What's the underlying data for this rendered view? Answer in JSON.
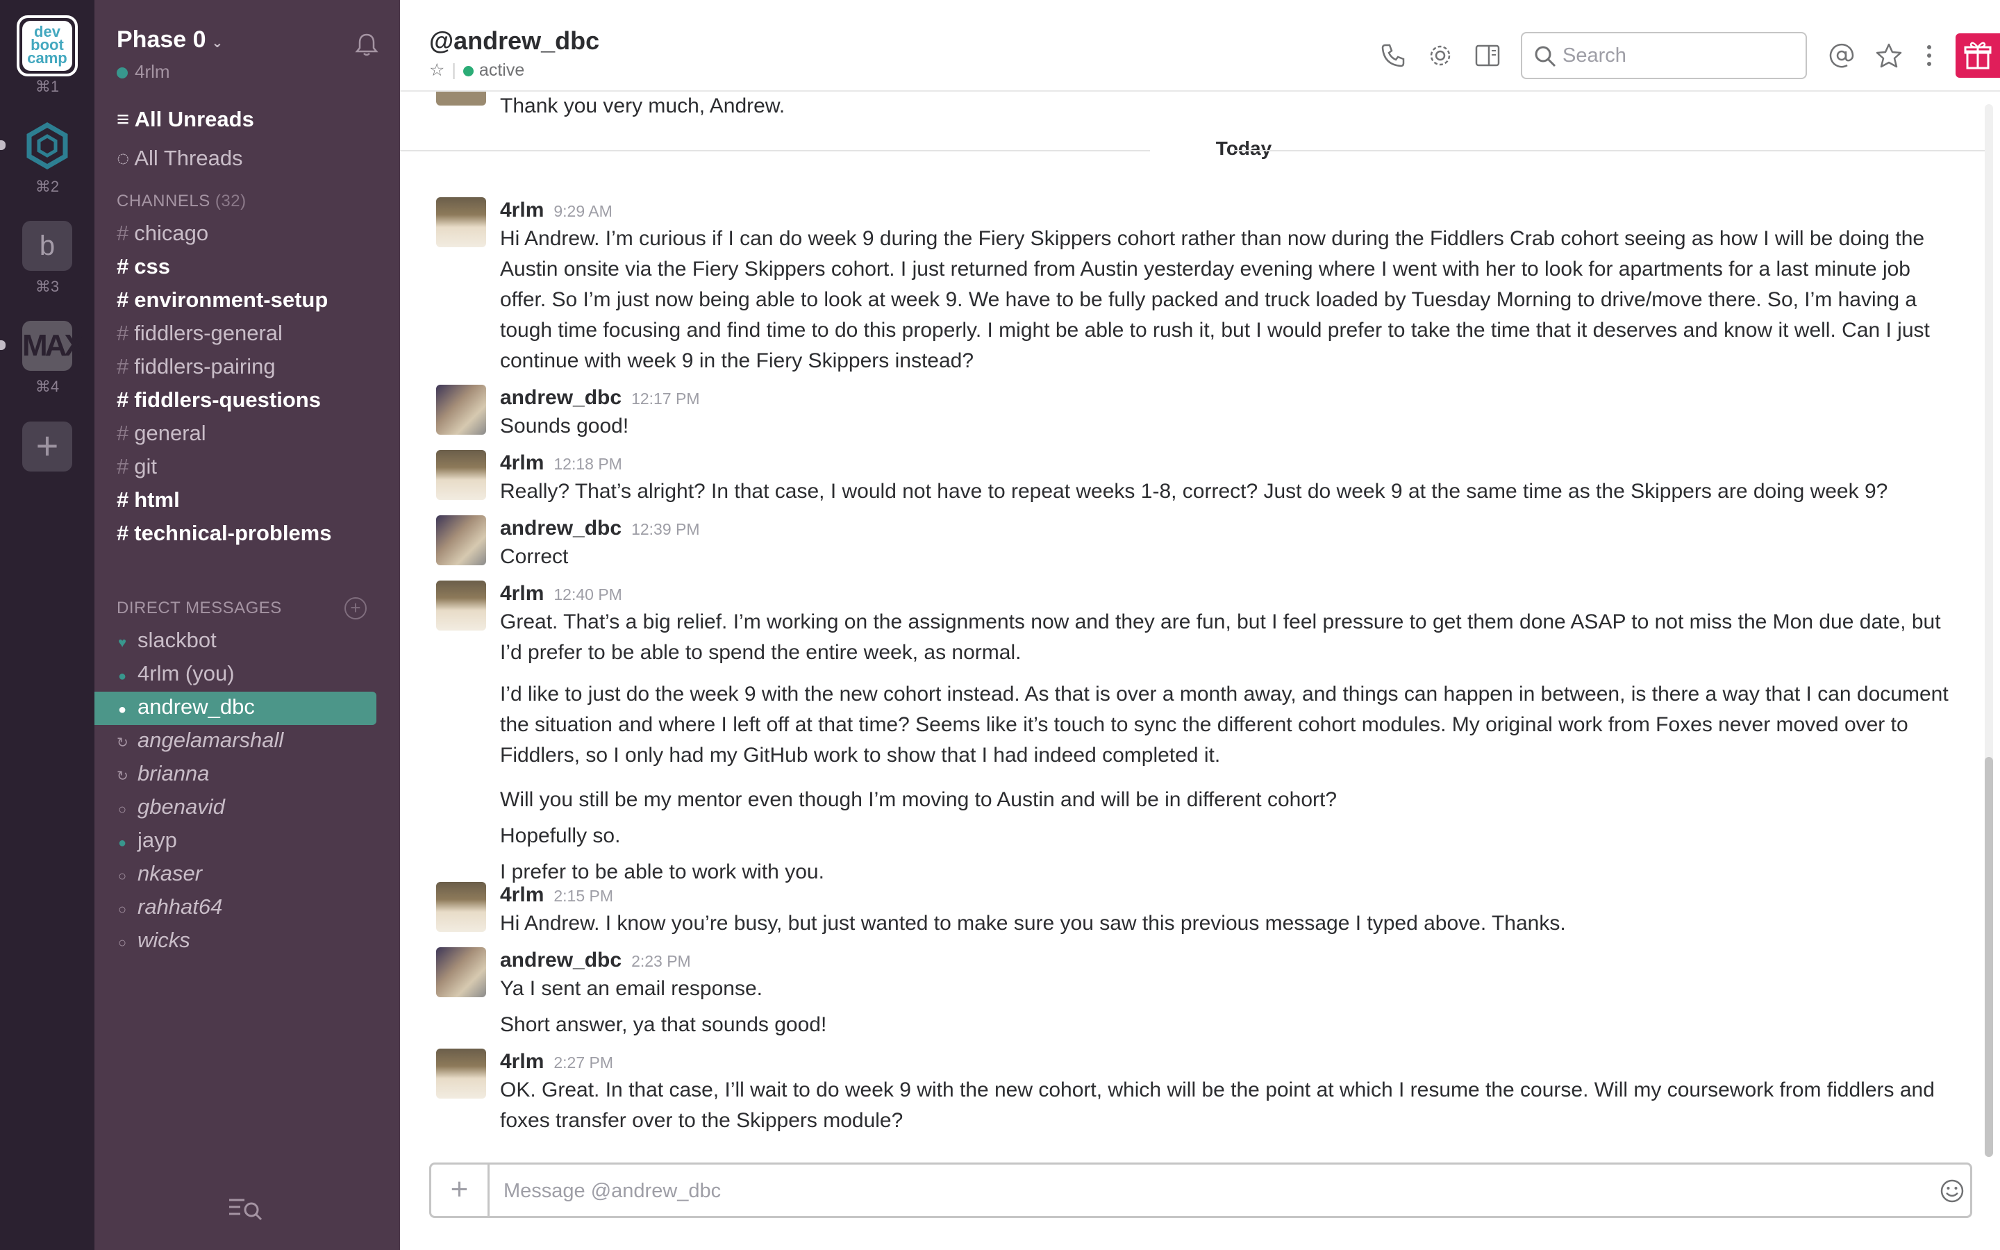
{
  "teams": [
    {
      "name": "dev boot camp",
      "logo_lines": [
        "dev",
        "boot",
        "camp"
      ],
      "shortcut": "⌘1"
    },
    {
      "name": "hex",
      "shortcut": "⌘2"
    },
    {
      "name": "b",
      "letter": "b",
      "shortcut": "⌘3"
    },
    {
      "name": "MAX",
      "letter": "MAX",
      "shortcut": "⌘4"
    }
  ],
  "sidebar": {
    "workspace": "Phase 0",
    "user": "4rlm",
    "all_unreads": "All Unreads",
    "all_threads": "All Threads",
    "channels_label": "CHANNELS",
    "channels_count": "(32)",
    "channels": [
      {
        "name": "chicago",
        "bold": false
      },
      {
        "name": "css",
        "bold": true
      },
      {
        "name": "environment-setup",
        "bold": true
      },
      {
        "name": "fiddlers-general",
        "bold": false
      },
      {
        "name": "fiddlers-pairing",
        "bold": false
      },
      {
        "name": "fiddlers-questions",
        "bold": true
      },
      {
        "name": "general",
        "bold": false
      },
      {
        "name": "git",
        "bold": false
      },
      {
        "name": "html",
        "bold": true
      },
      {
        "name": "technical-problems",
        "bold": true
      }
    ],
    "dm_label": "DIRECT MESSAGES",
    "dms": [
      {
        "name": "slackbot",
        "status": "heart"
      },
      {
        "name": "4rlm (you)",
        "status": "online"
      },
      {
        "name": "andrew_dbc",
        "status": "online",
        "selected": true
      },
      {
        "name": "angelamarshall",
        "status": "shared"
      },
      {
        "name": "brianna",
        "status": "shared"
      },
      {
        "name": "gbenavid",
        "status": "away"
      },
      {
        "name": "jayp",
        "status": "online"
      },
      {
        "name": "nkaser",
        "status": "away"
      },
      {
        "name": "rahhat64",
        "status": "away"
      },
      {
        "name": "wicks",
        "status": "away"
      }
    ]
  },
  "header": {
    "title": "@andrew_dbc",
    "presence": "active",
    "search_placeholder": "Search"
  },
  "conversation": {
    "cut_message": "Thank you very much, Andrew.",
    "day_divider": "Today",
    "messages": [
      {
        "user": "4rlm",
        "time": "9:29 AM",
        "lines": [
          "Hi Andrew.  I’m curious if I can do week 9 during the Fiery Skippers cohort rather than now during the Fiddlers Crab cohort seeing as how I will be doing the Austin onsite via the Fiery Skippers cohort.  I just returned from Austin yesterday evening where I went with her to look for apartments for a last minute job offer.  So I’m just now being able to look at week 9.  We have to be fully packed and truck loaded by Tuesday Morning to drive/move there.  So, I’m having a tough time focusing and find time to do this properly.  I might be able to rush it, but I would prefer to take the time that it deserves and know it well.  Can I just continue with week 9 in the Fiery Skippers instead?"
        ]
      },
      {
        "user": "andrew_dbc",
        "time": "12:17 PM",
        "lines": [
          "Sounds good!"
        ]
      },
      {
        "user": "4rlm",
        "time": "12:18 PM",
        "lines": [
          "Really?  That’s alright?  In that case, I would not have to repeat weeks 1-8, correct?  Just do week 9 at the same time as the Skippers are doing week 9?"
        ]
      },
      {
        "user": "andrew_dbc",
        "time": "12:39 PM",
        "lines": [
          "Correct"
        ]
      },
      {
        "user": "4rlm",
        "time": "12:40 PM",
        "lines": [
          "Great.  That’s a big relief.  I’m working on the assignments now and they are fun, but I feel pressure to get them done ASAP to not miss the Mon due date, but I’d prefer to be able to spend the entire week, as normal.",
          "I’d like to just do the week 9 with the new cohort instead.  As that is over a month away, and things can happen in between, is there a way that I can document the situation and where I left off at that time?  Seems like it’s touch to sync the different cohort modules.  My original work from Foxes never moved over to Fiddlers, so I only had my GitHub work to show that I had indeed completed it.",
          "Will you still be my mentor even though I’m moving to Austin and will be in different cohort?",
          "Hopefully so.",
          "I prefer to be able to work with you."
        ]
      },
      {
        "user": "4rlm",
        "time": "2:15 PM",
        "lines": [
          "Hi Andrew.  I know you’re busy, but just wanted to make sure you saw this previous message I typed above.  Thanks."
        ]
      },
      {
        "user": "andrew_dbc",
        "time": "2:23 PM",
        "lines": [
          "Ya I sent an email response.",
          "Short answer, ya that sounds good!"
        ]
      },
      {
        "user": "4rlm",
        "time": "2:27 PM",
        "lines": [
          "OK.  Great.  In that case, I’ll wait to do week 9 with the new cohort, which will be the point at which I resume the course.  Will my coursework from fiddlers and foxes transfer over to the Skippers module?"
        ]
      }
    ]
  },
  "composer": {
    "placeholder": "Message @andrew_dbc"
  },
  "colors": {
    "sidebar_bg": "#4d394b",
    "team_bar_bg": "#2b2130",
    "selected_dm": "#4c9689",
    "presence_green": "#2bac76"
  }
}
